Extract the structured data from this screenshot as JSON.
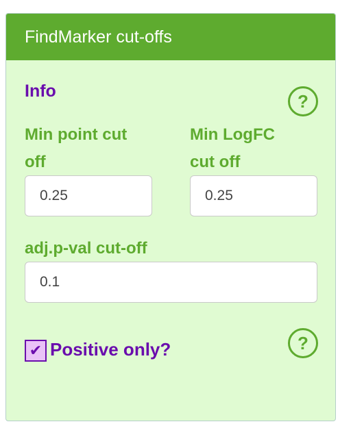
{
  "panel": {
    "title": "FindMarker cut-offs",
    "section_title": "Info",
    "help_icon_1": "?",
    "help_icon_2": "?"
  },
  "fields": {
    "min_point": {
      "label_line1": "Min point cut",
      "label_line2": "off",
      "value": "0.25"
    },
    "min_logfc": {
      "label_line1": "Min LogFC",
      "label_line2": "cut off",
      "value": "0.25"
    },
    "adj_pval": {
      "label": "adj.p-val cut-off",
      "value": "0.1"
    }
  },
  "positive_only": {
    "label": "Positive only?",
    "checked": true,
    "check_glyph": "✔"
  },
  "colors": {
    "header_bg": "#5eab2f",
    "panel_bg": "#e0fbd2",
    "label_green": "#5eab2f",
    "title_purple": "#6a0dad",
    "checkbox_fill": "#e9c2f7"
  },
  "icons": [
    "help-circle-icon",
    "checkmark-icon"
  ]
}
